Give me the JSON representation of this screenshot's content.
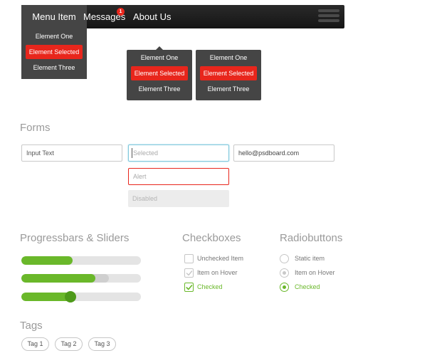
{
  "nav": {
    "items": [
      {
        "label": "Menu Item"
      },
      {
        "label": "Messages",
        "badge": "1"
      },
      {
        "label": "About Us"
      }
    ],
    "menu_icon": "hamburger-icon"
  },
  "dropdowns": [
    {
      "items": [
        "Element One",
        "Element Selected",
        "Element Three"
      ],
      "selected_index": 1
    },
    {
      "items": [
        "Element One",
        "Element Selected",
        "Element Three"
      ],
      "selected_index": 1
    },
    {
      "items": [
        "Element One",
        "Element Selected",
        "Element Three"
      ],
      "selected_index": 1
    }
  ],
  "forms": {
    "title": "Forms",
    "input_text_placeholder": "Input Text",
    "selected_placeholder": "Selected",
    "email_value": "hello@psdboard.com",
    "alert_placeholder": "Alert",
    "disabled_placeholder": "Disabled"
  },
  "progress": {
    "title": "Progressbars & Sliders",
    "bars": [
      {
        "value": 0.43
      },
      {
        "value": 0.62,
        "buffer": 0.73
      },
      {
        "value": 0.41,
        "slider": true
      }
    ]
  },
  "checkboxes": {
    "title": "Checkboxes",
    "items": [
      {
        "label": "Unchecked Item",
        "state": "unchecked"
      },
      {
        "label": "Item on Hover",
        "state": "hover"
      },
      {
        "label": "Checked",
        "state": "checked"
      }
    ]
  },
  "radios": {
    "title": "Radiobuttons",
    "items": [
      {
        "label": "Static item",
        "state": "static"
      },
      {
        "label": "Item on Hover",
        "state": "hover"
      },
      {
        "label": "Checked",
        "state": "checked"
      }
    ]
  },
  "tags": {
    "title": "Tags",
    "items": [
      "Tag 1",
      "Tag 2",
      "Tag 3"
    ]
  },
  "colors": {
    "accent_red": "#e8261c",
    "accent_green": "#6ab82a",
    "nav_dark": "#1c1c1c",
    "dropdown_bg": "#454545"
  }
}
